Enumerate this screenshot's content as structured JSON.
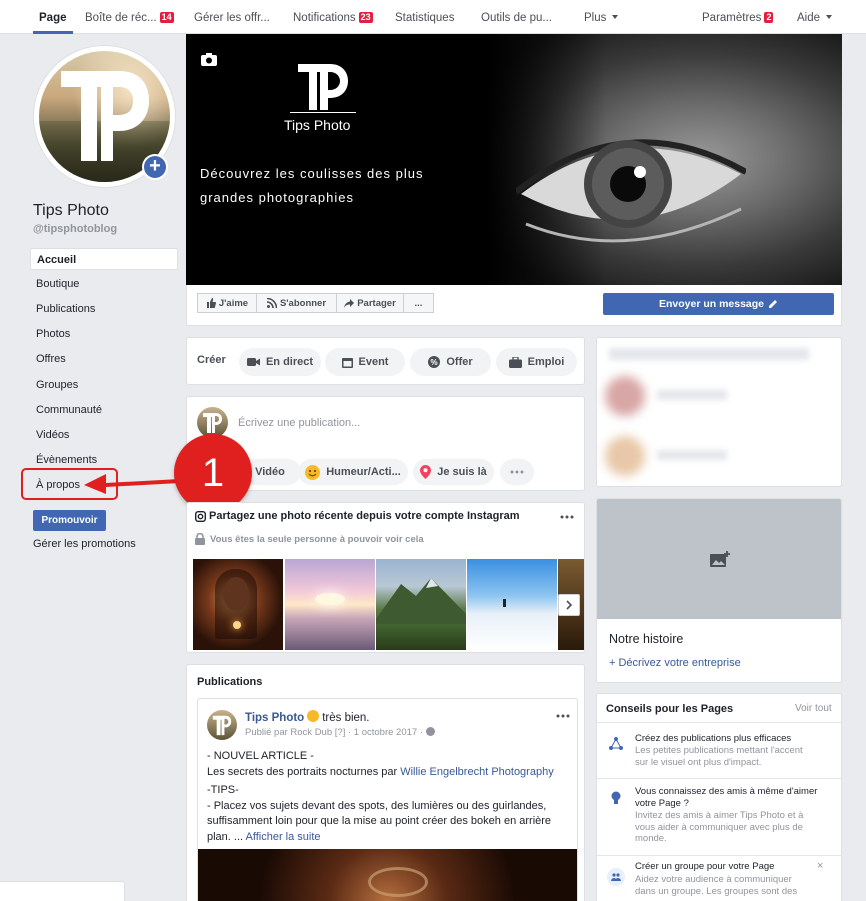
{
  "topnav": {
    "tabs": [
      {
        "label": "Page",
        "active": true
      },
      {
        "label": "Boîte de réc...",
        "badge": "14"
      },
      {
        "label": "Gérer les offr..."
      },
      {
        "label": "Notifications",
        "badge": "23"
      },
      {
        "label": "Statistiques"
      },
      {
        "label": "Outils de pu..."
      },
      {
        "label": "Plus"
      }
    ],
    "settings": {
      "label": "Paramètres",
      "badge": "2"
    },
    "help": {
      "label": "Aide"
    }
  },
  "profile": {
    "name": "Tips Photo",
    "handle": "@tipsphotoblog"
  },
  "sidebar": {
    "items": [
      {
        "label": "Accueil",
        "active": true
      },
      {
        "label": "Boutique"
      },
      {
        "label": "Publications"
      },
      {
        "label": "Photos"
      },
      {
        "label": "Offres"
      },
      {
        "label": "Groupes"
      },
      {
        "label": "Communauté"
      },
      {
        "label": "Vidéos"
      },
      {
        "label": "Évènements"
      },
      {
        "label": "À propos"
      }
    ],
    "promote_button": "Promouvoir",
    "manage_promotions": "Gérer les promotions"
  },
  "annotation": {
    "number": "1",
    "color": "#e0201e"
  },
  "cover": {
    "logo_text": "Tips Photo",
    "tagline_line1": "Découvrez les coulisses des plus",
    "tagline_line2": "grandes photographies"
  },
  "actions": {
    "like": "J'aime",
    "subscribe": "S'abonner",
    "share": "Partager",
    "more": "...",
    "send_message": "Envoyer un message"
  },
  "create": {
    "label": "Créer",
    "live": "En direct",
    "event": "Event",
    "offer": "Offer",
    "job": "Emploi"
  },
  "composer": {
    "placeholder": "Écrivez une publication...",
    "video": "Vidéo",
    "mood": "Humeur/Acti...",
    "checkin": "Je suis là"
  },
  "instagram": {
    "title": "Partagez une photo récente depuis votre compte Instagram",
    "privacy": "Vous êtes la seule personne à pouvoir voir cela"
  },
  "publications": {
    "header": "Publications",
    "post": {
      "author": "Tips Photo",
      "feeling": "très bien.",
      "meta": "Publié par Rock Dub",
      "meta_q": "[?]",
      "date": "1 octobre 2017",
      "line1": "- NOUVEL ARTICLE -",
      "line2_prefix": "Les secrets des portraits nocturnes par ",
      "line2_link": "Willie Engelbrecht Photography",
      "line3": "-TIPS-",
      "line4": "- Placez vos sujets devant des spots, des lumières ou des guirlandes,",
      "line5": "suffisamment loin pour que la mise au point créer des bokeh en arrière",
      "line6_prefix": "plan. ... ",
      "line6_link": "Afficher la suite"
    }
  },
  "story": {
    "title": "Notre histoire",
    "describe": "+ Décrivez votre entreprise"
  },
  "tips": {
    "header": "Conseils pour les Pages",
    "see_all": "Voir tout",
    "items": [
      {
        "title": "Créez des publications plus efficaces",
        "body": [
          "Les petites publications mettant l'accent",
          "sur le visuel ont plus d'impact."
        ]
      },
      {
        "title": "Vous connaissez des amis à même d'aimer votre Page ?",
        "body": [
          "Invitez des amis à aimer Tips Photo et à",
          "vous aider à communiquer avec plus de",
          "monde."
        ]
      },
      {
        "title": "Créer un groupe pour votre Page",
        "body": [
          "Aidez votre audience à communiquer",
          "dans un groupe. Les groupes sont des"
        ]
      }
    ]
  },
  "colors": {
    "brand": "#4267b2",
    "link": "#385898",
    "alert": "#e41e3f"
  }
}
